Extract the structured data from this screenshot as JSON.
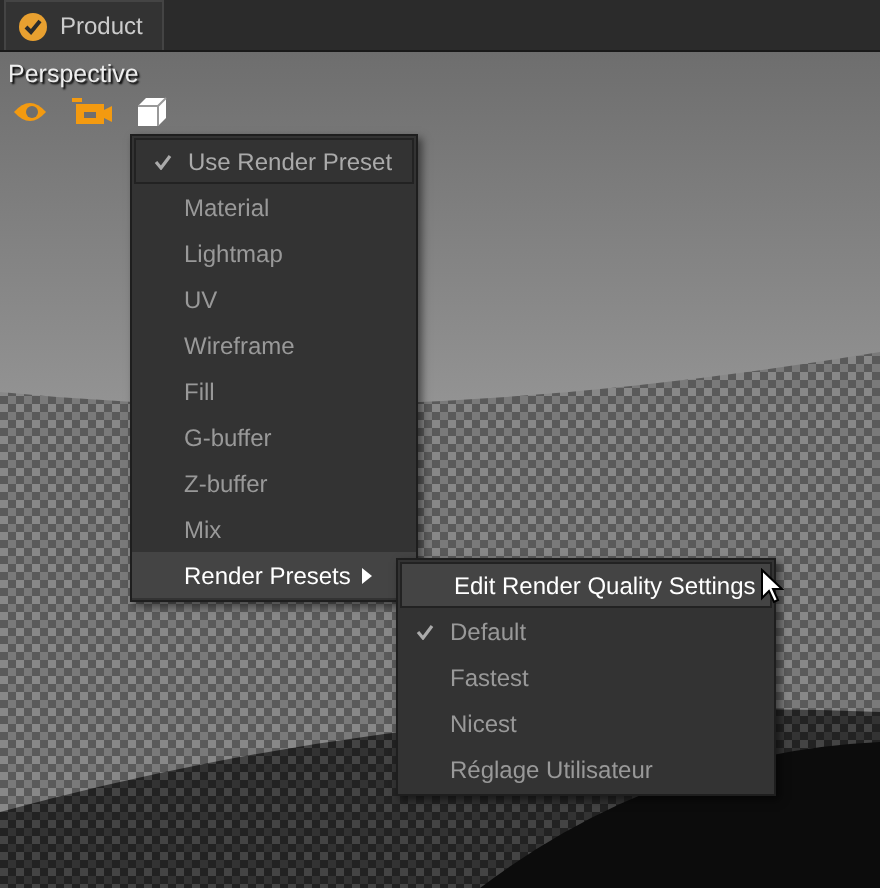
{
  "tab": {
    "label": "Product",
    "selected": true
  },
  "viewport": {
    "label": "Perspective"
  },
  "menu": [
    {
      "label": "Use Render Preset",
      "kind": "toggle",
      "checked": true,
      "highlighted": false
    },
    {
      "label": "Material",
      "kind": "item",
      "highlighted": false
    },
    {
      "label": "Lightmap",
      "kind": "item",
      "highlighted": false
    },
    {
      "label": "UV",
      "kind": "item",
      "highlighted": false
    },
    {
      "label": "Wireframe",
      "kind": "item",
      "highlighted": false
    },
    {
      "label": "Fill",
      "kind": "item",
      "highlighted": false
    },
    {
      "label": "G-buffer",
      "kind": "item",
      "highlighted": false
    },
    {
      "label": "Z-buffer",
      "kind": "item",
      "highlighted": false
    },
    {
      "label": "Mix",
      "kind": "item",
      "highlighted": false
    },
    {
      "label": "Render Presets",
      "kind": "submenu",
      "highlighted": true
    }
  ],
  "submenu": [
    {
      "label": "Edit Render Quality Settings",
      "kind": "action",
      "highlighted": true
    },
    {
      "label": "Default",
      "kind": "radio",
      "checked": true,
      "highlighted": false
    },
    {
      "label": "Fastest",
      "kind": "radio",
      "checked": false,
      "highlighted": false
    },
    {
      "label": "Nicest",
      "kind": "radio",
      "checked": false,
      "highlighted": false
    },
    {
      "label": "Réglage Utilisateur",
      "kind": "radio",
      "checked": false,
      "highlighted": false
    }
  ]
}
